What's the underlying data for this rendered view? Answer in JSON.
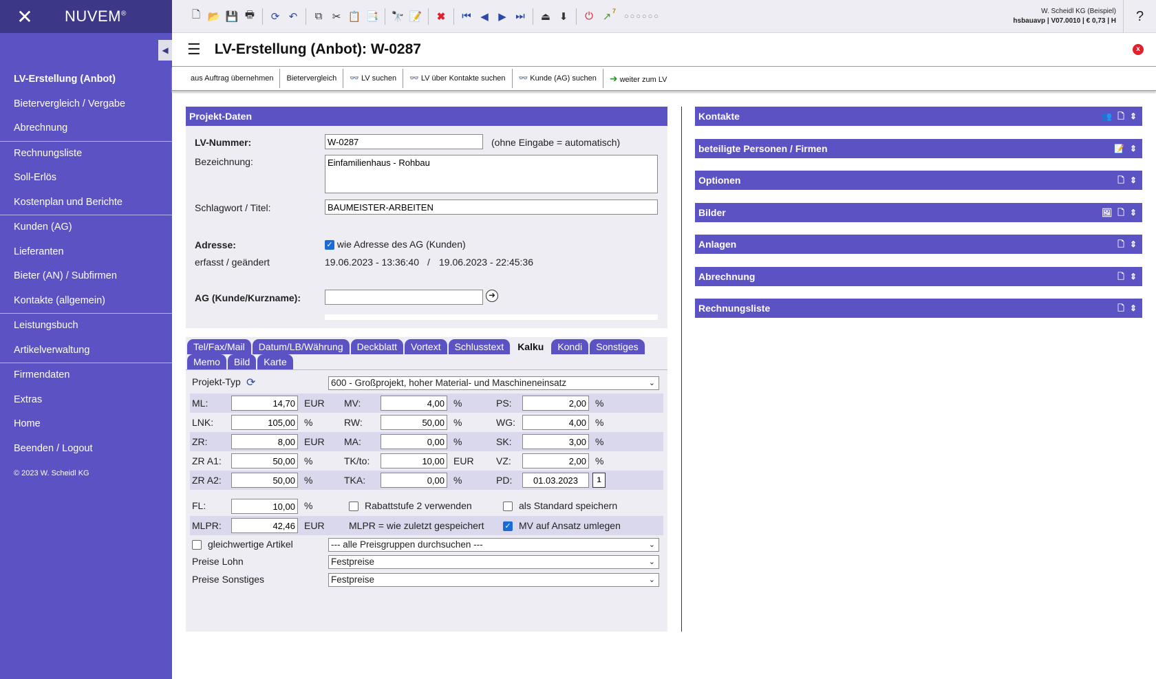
{
  "app": {
    "brand": "NUVEM",
    "brand_mark": "®",
    "logo_glyph": "✕"
  },
  "sidebar": {
    "items": [
      {
        "label": "LV-Erstellung (Anbot)",
        "active": true
      },
      {
        "label": "Bietervergleich / Vergabe"
      },
      {
        "label": "Abrechnung"
      },
      {
        "label": "Rechnungsliste"
      },
      {
        "label": "Soll-Erlös"
      },
      {
        "label": "Kostenplan und Berichte"
      },
      {
        "label": "Kunden (AG)"
      },
      {
        "label": "Lieferanten"
      },
      {
        "label": "Bieter (AN) / Subfirmen"
      },
      {
        "label": "Kontakte (allgemein)"
      },
      {
        "label": "Leistungsbuch"
      },
      {
        "label": "Artikelverwaltung"
      },
      {
        "label": "Firmendaten"
      },
      {
        "label": "Extras"
      },
      {
        "label": "Home"
      },
      {
        "label": "Beenden / Logout"
      }
    ],
    "copyright": "© 2023 W. Scheidl KG",
    "collapse_icon": "◀"
  },
  "topbar": {
    "user_line1": "W. Scheidl KG (Beispiel)",
    "user_line2": "hsbauavp | V07.0010 | € 0,73 | H",
    "help": "?",
    "badge": "7",
    "dots": "○○○○○○"
  },
  "title": {
    "text": "LV-Erstellung (Anbot): W-0287",
    "close": "x"
  },
  "actions": [
    {
      "label": "aus Auftrag übernehmen",
      "icon": ""
    },
    {
      "label": "Bietervergleich",
      "icon": ""
    },
    {
      "label": "LV suchen",
      "icon": "binoculars-icon"
    },
    {
      "label": "LV über Kontakte suchen",
      "icon": "binoculars-icon"
    },
    {
      "label": "Kunde (AG) suchen",
      "icon": "binoculars-icon"
    },
    {
      "label": "weiter zum LV",
      "icon": "arrow-right-icon"
    }
  ],
  "project": {
    "heading": "Projekt-Daten",
    "lv_label": "LV-Nummer:",
    "lv_value": "W-0287",
    "lv_hint": "(ohne Eingabe = automatisch)",
    "bez_label": "Bezeichnung:",
    "bez_value": "Einfamilienhaus - Rohbau",
    "schlag_label": "Schlagwort / Titel:",
    "schlag_value": "BAUMEISTER-ARBEITEN",
    "adr_label": "Adresse:",
    "adr_check": "wie Adresse des AG (Kunden)",
    "erfasst_label": "erfasst / geändert",
    "erfasst_value": "19.06.2023 - 13:36:40",
    "sep": "/",
    "geaendert_value": "19.06.2023 - 22:45:36",
    "ag_label": "AG (Kunde/Kurzname):",
    "ag_value": ""
  },
  "tabs_row1": [
    "Tel/Fax/Mail",
    "Datum/LB/Währung",
    "Deckblatt",
    "Vortext",
    "Schlusstext",
    "Kalku",
    "Kondi",
    "Sonstiges"
  ],
  "tabs_row2": [
    "Memo",
    "Bild",
    "Karte"
  ],
  "active_tab": "Kalku",
  "kalku": {
    "projekt_typ_label": "Projekt-Typ",
    "projekt_typ_value": "600 - Großprojekt, hoher Material- und Maschineneinsatz",
    "rows": [
      {
        "a": {
          "l": "ML:",
          "v": "14,70",
          "u": "EUR"
        },
        "b": {
          "l": "MV:",
          "v": "4,00",
          "u": "%"
        },
        "c": {
          "l": "PS:",
          "v": "2,00",
          "u": "%"
        }
      },
      {
        "a": {
          "l": "LNK:",
          "v": "105,00",
          "u": "%"
        },
        "b": {
          "l": "RW:",
          "v": "50,00",
          "u": "%"
        },
        "c": {
          "l": "WG:",
          "v": "4,00",
          "u": "%"
        }
      },
      {
        "a": {
          "l": "ZR:",
          "v": "8,00",
          "u": "EUR"
        },
        "b": {
          "l": "MA:",
          "v": "0,00",
          "u": "%"
        },
        "c": {
          "l": "SK:",
          "v": "3,00",
          "u": "%"
        }
      },
      {
        "a": {
          "l": "ZR A1:",
          "v": "50,00",
          "u": "%"
        },
        "b": {
          "l": "TK/to:",
          "v": "10,00",
          "u": "EUR"
        },
        "c": {
          "l": "VZ:",
          "v": "2,00",
          "u": "%"
        }
      },
      {
        "a": {
          "l": "ZR A2:",
          "v": "50,00",
          "u": "%"
        },
        "b": {
          "l": "TKA:",
          "v": "0,00",
          "u": "%"
        },
        "c": {
          "l": "PD:",
          "v": "01.03.2023",
          "u": ""
        }
      }
    ],
    "pd_cal": "1",
    "fl_label": "FL:",
    "fl_value": "10,00",
    "fl_unit": "%",
    "rabatt": "Rabattstufe 2 verwenden",
    "standard": "als Standard speichern",
    "mlpr_label": "MLPR:",
    "mlpr_value": "42,46",
    "mlpr_unit": "EUR",
    "mlpr_note": "MLPR = wie zuletzt gespeichert",
    "mv_umlegen": "MV auf Ansatz umlegen",
    "gleich": "gleichwertige Artikel",
    "gleich_sel": "--- alle Preisgruppen durchsuchen ---",
    "lohn_label": "Preise Lohn",
    "lohn_sel": "Festpreise",
    "sonst_label": "Preise Sonstiges",
    "sonst_sel": "Festpreise"
  },
  "right_panels": [
    {
      "label": "Kontakte",
      "icons": [
        "people-icon",
        "document-icon",
        "expand-icon"
      ]
    },
    {
      "label": "beteiligte Personen / Firmen",
      "icons": [
        "edit-icon",
        "expand-icon"
      ]
    },
    {
      "label": "Optionen",
      "icons": [
        "document-icon",
        "expand-icon"
      ]
    },
    {
      "label": "Bilder",
      "icons": [
        "image-icon",
        "document-icon",
        "expand-icon"
      ]
    },
    {
      "label": "Anlagen",
      "icons": [
        "document-icon",
        "expand-icon"
      ]
    },
    {
      "label": "Abrechnung",
      "icons": [
        "document-icon",
        "expand-icon"
      ]
    },
    {
      "label": "Rechnungsliste",
      "icons": [
        "document-icon",
        "expand-icon"
      ]
    }
  ],
  "colors": {
    "accent": "#5b52c4",
    "dark": "#3d3787",
    "panel_bg": "#ededf3",
    "close": "#e0202a"
  }
}
